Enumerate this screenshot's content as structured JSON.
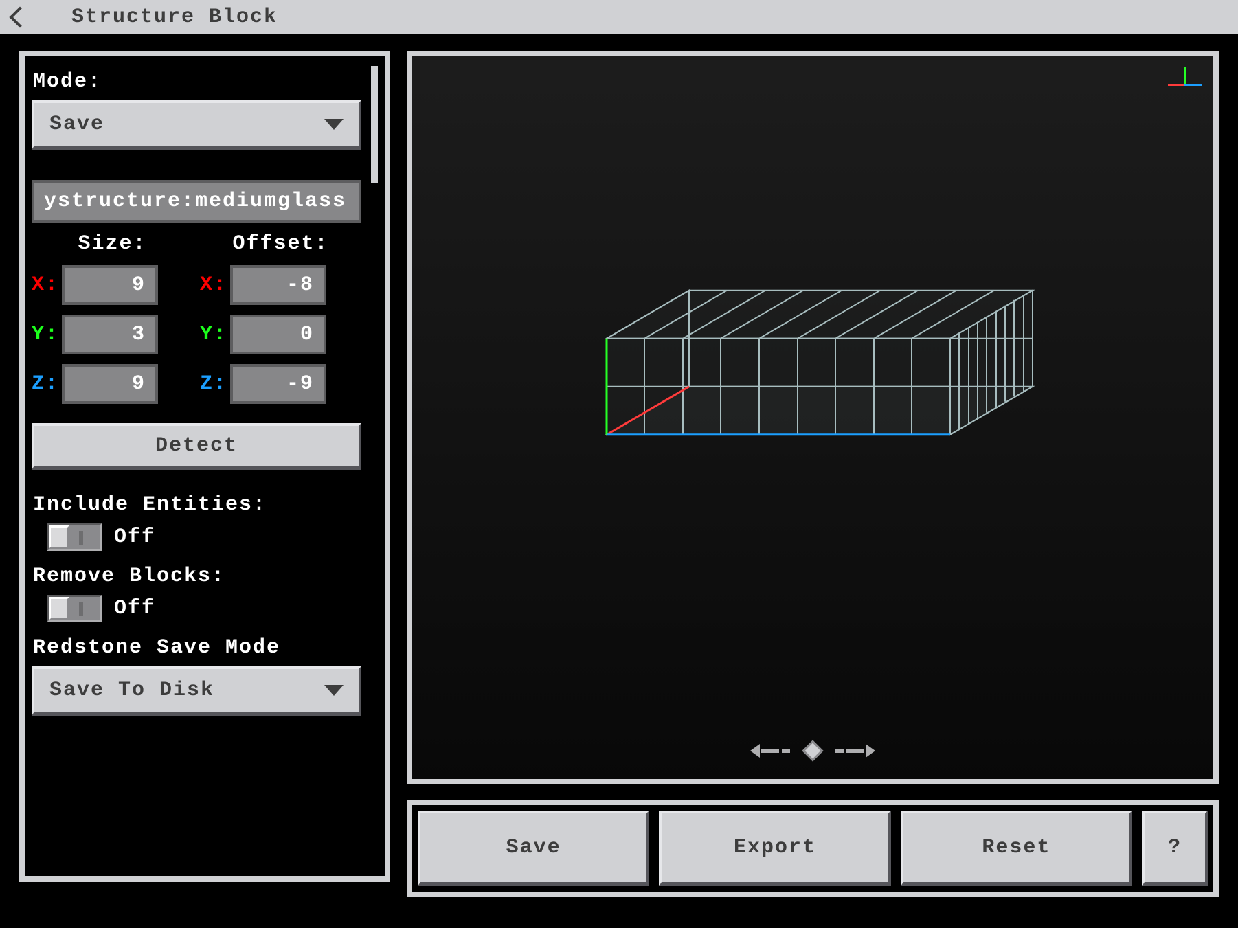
{
  "topbar": {
    "title": "Structure Block"
  },
  "mode": {
    "label": "Mode:",
    "selected": "Save"
  },
  "structure_name": "ystructure:mediumglass",
  "size": {
    "label": "Size:",
    "x": "9",
    "y": "3",
    "z": "9"
  },
  "offset": {
    "label": "Offset:",
    "x": "-8",
    "y": "0",
    "z": "-9"
  },
  "axis_labels": {
    "x": "X:",
    "y": "Y:",
    "z": "Z:"
  },
  "detect_label": "Detect",
  "include_entities": {
    "label": "Include Entities:",
    "state": "Off"
  },
  "remove_blocks": {
    "label": "Remove Blocks:",
    "state": "Off"
  },
  "redstone": {
    "label": "Redstone Save Mode",
    "selected": "Save To Disk"
  },
  "buttons": {
    "save": "Save",
    "export": "Export",
    "reset": "Reset",
    "help": "?"
  }
}
